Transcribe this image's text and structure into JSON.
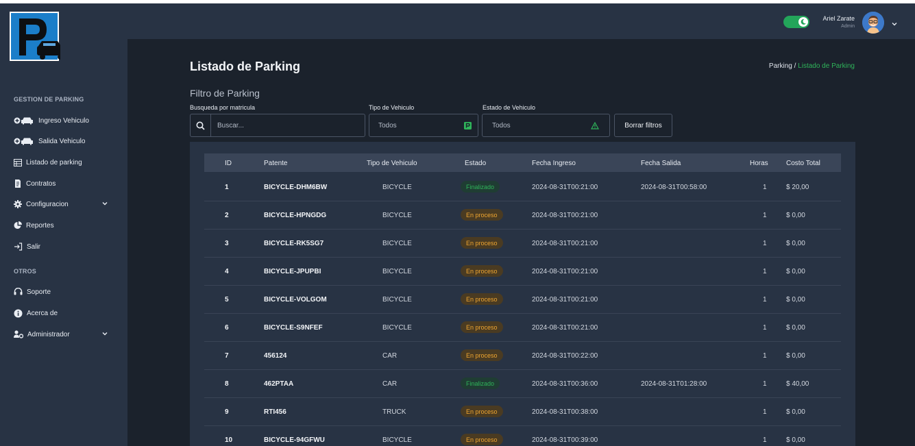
{
  "sidebar": {
    "section_parking": "GESTION DE PARKING",
    "section_otros": "OTROS",
    "items": [
      {
        "label": "Ingreso Vehiculo",
        "icon": "plus-car-icon"
      },
      {
        "label": "Salida Vehiculo",
        "icon": "plus-car-icon"
      },
      {
        "label": "Listado de parking",
        "icon": "table-icon"
      },
      {
        "label": "Contratos",
        "icon": "document-icon"
      },
      {
        "label": "Configuracion",
        "icon": "gear-icon"
      },
      {
        "label": "Reportes",
        "icon": "pie-chart-icon"
      },
      {
        "label": "Salir",
        "icon": "logout-icon"
      },
      {
        "label": "Soporte",
        "icon": "headset-icon"
      },
      {
        "label": "Acerca de",
        "icon": "info-icon"
      },
      {
        "label": "Administrador",
        "icon": "users-gear-icon"
      }
    ]
  },
  "header": {
    "user_name": "Ariel Zarate",
    "user_role": "Admin",
    "theme_toggle": "on"
  },
  "page": {
    "title": "Listado de Parking",
    "breadcrumb_root": "Parking /",
    "breadcrumb_active": "Listado de Parking"
  },
  "filters": {
    "title": "Filtro de Parking",
    "search_label": "Busqueda por matricula",
    "search_placeholder": "Buscar...",
    "vehicle_label": "Tipo de Vehiculo",
    "vehicle_value": "Todos",
    "status_label": "Estado de Vehiculo",
    "status_value": "Todos",
    "clear_button": "Borrar filtros"
  },
  "table": {
    "headers": [
      "ID",
      "Patente",
      "Tipo de Vehiculo",
      "Estado",
      "Fecha Ingreso",
      "Fecha Salida",
      "Horas",
      "Costo Total"
    ],
    "rows": [
      {
        "id": "1",
        "patente": "BICYCLE-DHM6BW",
        "tipo": "BICYCLE",
        "estado": "Finalizado",
        "ingreso": "2024-08-31T00:21:00",
        "salida": "2024-08-31T00:58:00",
        "horas": "1",
        "costo": "$ 20,00"
      },
      {
        "id": "2",
        "patente": "BICYCLE-HPNGDG",
        "tipo": "BICYCLE",
        "estado": "En proceso",
        "ingreso": "2024-08-31T00:21:00",
        "salida": "",
        "horas": "1",
        "costo": "$ 0,00"
      },
      {
        "id": "3",
        "patente": "BICYCLE-RK5SG7",
        "tipo": "BICYCLE",
        "estado": "En proceso",
        "ingreso": "2024-08-31T00:21:00",
        "salida": "",
        "horas": "1",
        "costo": "$ 0,00"
      },
      {
        "id": "4",
        "patente": "BICYCLE-JPUPBI",
        "tipo": "BICYCLE",
        "estado": "En proceso",
        "ingreso": "2024-08-31T00:21:00",
        "salida": "",
        "horas": "1",
        "costo": "$ 0,00"
      },
      {
        "id": "5",
        "patente": "BICYCLE-VOLGOM",
        "tipo": "BICYCLE",
        "estado": "En proceso",
        "ingreso": "2024-08-31T00:21:00",
        "salida": "",
        "horas": "1",
        "costo": "$ 0,00"
      },
      {
        "id": "6",
        "patente": "BICYCLE-S9NFEF",
        "tipo": "BICYCLE",
        "estado": "En proceso",
        "ingreso": "2024-08-31T00:21:00",
        "salida": "",
        "horas": "1",
        "costo": "$ 0,00"
      },
      {
        "id": "7",
        "patente": "456124",
        "tipo": "CAR",
        "estado": "En proceso",
        "ingreso": "2024-08-31T00:22:00",
        "salida": "",
        "horas": "1",
        "costo": "$ 0,00"
      },
      {
        "id": "8",
        "patente": "462PTAA",
        "tipo": "CAR",
        "estado": "Finalizado",
        "ingreso": "2024-08-31T00:36:00",
        "salida": "2024-08-31T01:28:00",
        "horas": "1",
        "costo": "$ 40,00"
      },
      {
        "id": "9",
        "patente": "RTI456",
        "tipo": "TRUCK",
        "estado": "En proceso",
        "ingreso": "2024-08-31T00:38:00",
        "salida": "",
        "horas": "1",
        "costo": "$ 0,00"
      },
      {
        "id": "10",
        "patente": "BICYCLE-94GFWU",
        "tipo": "BICYCLE",
        "estado": "En proceso",
        "ingreso": "2024-08-31T00:39:00",
        "salida": "",
        "horas": "1",
        "costo": "$ 0,00"
      }
    ]
  },
  "colors": {
    "sidebar_bg": "#283344",
    "main_bg": "#1b222c",
    "accent_green": "#2fb45a",
    "status_finished": "#2fb45a",
    "status_in_progress": "#f0a630"
  }
}
